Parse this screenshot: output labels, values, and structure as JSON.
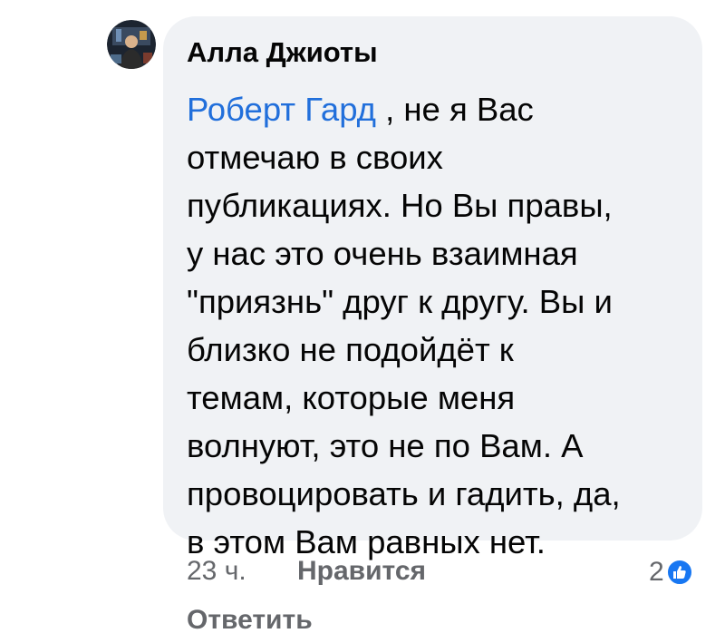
{
  "comment": {
    "author": "Алла Джиоты",
    "mention": "Роберт Гард",
    "first_line_rest": " , не я Вас",
    "lines": [
      "отмечаю в своих",
      "публикациях. Но Вы правы,",
      "у нас это очень взаимная",
      "\"приязнь\" друг к другу. Вы и",
      "близко не подойдёт к",
      "темам, которые меня",
      "волнуют, это не по Вам. А",
      "провоцировать и гадить, да,",
      "в этом Вам равных нет."
    ],
    "time": "23 ч.",
    "like_label": "Нравится",
    "reply_label": "Ответить",
    "reaction_count": "2",
    "reaction_icon": "thumbs-up-icon"
  },
  "colors": {
    "mention": "#216fdb",
    "bubble": "#f0f2f5",
    "meta_text": "#65676b",
    "like_badge": "#1877f2"
  }
}
